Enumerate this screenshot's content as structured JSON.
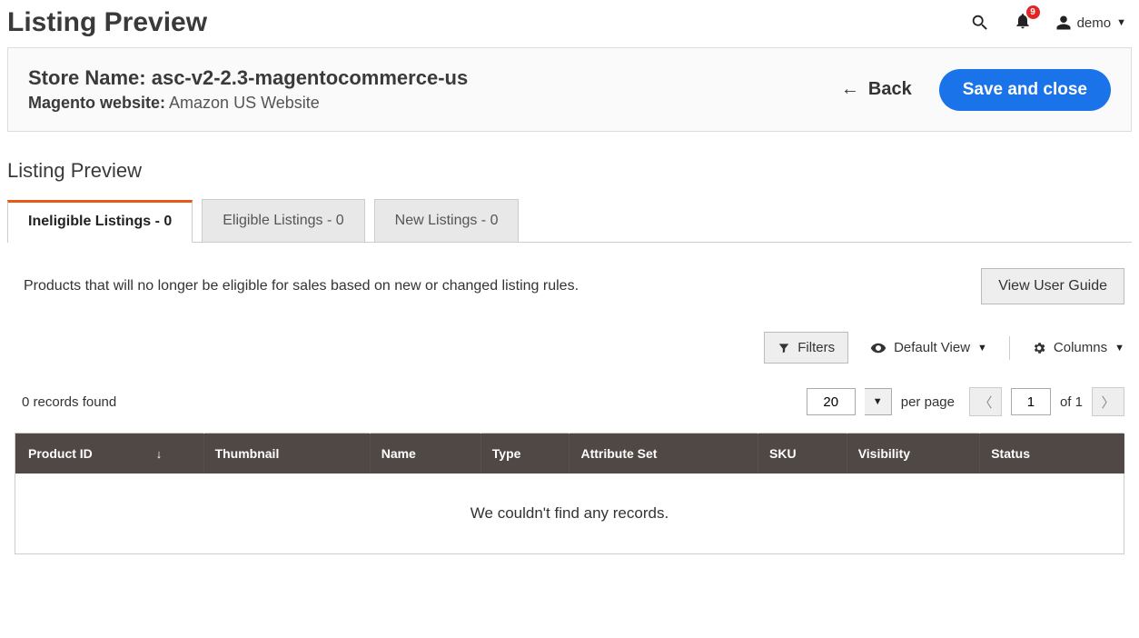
{
  "header": {
    "page_title": "Listing Preview",
    "notifications_count": "9",
    "user_name": "demo"
  },
  "store_panel": {
    "store_label": "Store Name:",
    "store_value": "asc-v2-2.3-magentocommerce-us",
    "website_label": "Magento website:",
    "website_value": "Amazon US Website",
    "back_label": "Back",
    "save_label": "Save and close"
  },
  "section_title": "Listing Preview",
  "tabs": [
    {
      "label": "Ineligible Listings - 0"
    },
    {
      "label": "Eligible Listings - 0"
    },
    {
      "label": "New Listings - 0"
    }
  ],
  "description": "Products that will no longer be eligible for sales based on new or changed listing rules.",
  "buttons": {
    "view_guide": "View User Guide",
    "filters": "Filters",
    "default_view": "Default View",
    "columns": "Columns"
  },
  "pager": {
    "records_text": "0 records found",
    "page_size": "20",
    "per_page_label": "per page",
    "current_page": "1",
    "of_label": "of 1"
  },
  "table": {
    "columns": [
      "Product ID",
      "Thumbnail",
      "Name",
      "Type",
      "Attribute Set",
      "SKU",
      "Visibility",
      "Status"
    ],
    "empty_message": "We couldn't find any records."
  }
}
